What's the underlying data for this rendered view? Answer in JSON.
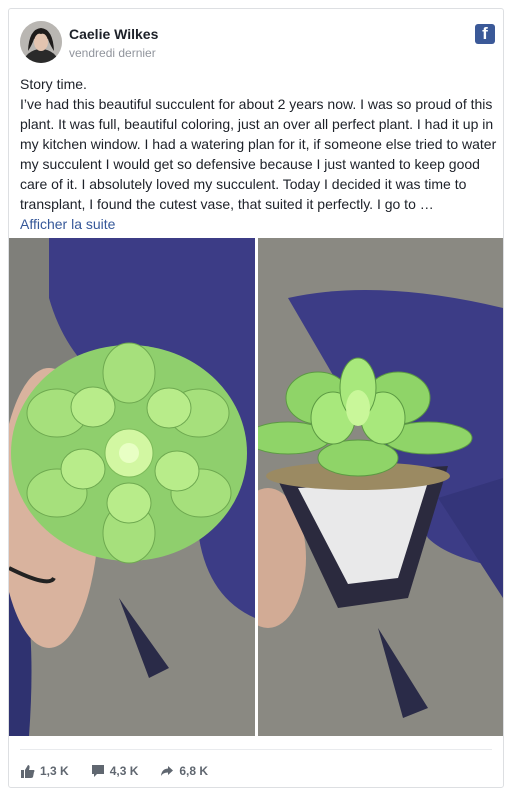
{
  "post": {
    "author": "Caelie Wilkes",
    "timestamp": "vendredi dernier",
    "text_lines": [
      "Story time.",
      "I’ve had this beautiful succulent for about 2 years now. I was so proud of this plant. It was full, beautiful coloring, just an over all perfect plant. I had it up in my kitchen window. I had a watering plan for it, if someone else tried to water my succulent I would get so defensive because I just wanted to keep good care of it. I absolutely loved my succulent. Today I decided it was time to transplant, I found the cutest vase, that suited it perfectly. I go to …"
    ],
    "see_more": "Afficher la suite",
    "facebook_icon": "facebook-icon"
  },
  "photos": [
    {
      "icon": "succulent-in-hand-photo"
    },
    {
      "icon": "succulent-in-pot-photo"
    }
  ],
  "stats": {
    "likes": "1,3 K",
    "comments": "4,3 K",
    "shares": "6,8 K"
  },
  "colors": {
    "brand": "#3b5998",
    "link": "#365899",
    "text": "#1d2129",
    "muted": "#90949c"
  }
}
